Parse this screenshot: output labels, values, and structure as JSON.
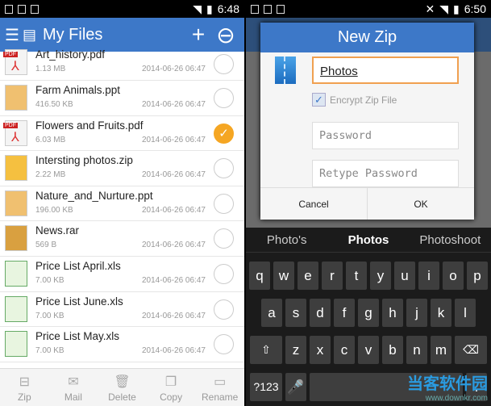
{
  "left": {
    "status_time": "6:48",
    "title": "My Files",
    "files": [
      {
        "name": "Art_history.pdf",
        "size": "1.13 MB",
        "date": "2014-06-26 06:47",
        "type": "pdf",
        "checked": false
      },
      {
        "name": "Farm Animals.ppt",
        "size": "416.50 KB",
        "date": "2014-06-26 06:47",
        "type": "ppt",
        "checked": false
      },
      {
        "name": "Flowers and Fruits.pdf",
        "size": "6.03 MB",
        "date": "2014-06-26 06:47",
        "type": "pdf",
        "checked": true
      },
      {
        "name": "Intersting photos.zip",
        "size": "2.22 MB",
        "date": "2014-06-26 06:47",
        "type": "zip",
        "checked": false
      },
      {
        "name": "Nature_and_Nurture.ppt",
        "size": "196.00 KB",
        "date": "2014-06-26 06:47",
        "type": "ppt",
        "checked": false
      },
      {
        "name": "News.rar",
        "size": "569 B",
        "date": "2014-06-26 06:47",
        "type": "rar",
        "checked": false
      },
      {
        "name": "Price List April.xls",
        "size": "7.00 KB",
        "date": "2014-06-26 06:47",
        "type": "xls",
        "checked": false
      },
      {
        "name": "Price List June.xls",
        "size": "7.00 KB",
        "date": "2014-06-26 06:47",
        "type": "xls",
        "checked": false
      },
      {
        "name": "Price List May.xls",
        "size": "7.00 KB",
        "date": "2014-06-26 06:47",
        "type": "xls",
        "checked": false
      }
    ],
    "toolbar": [
      {
        "label": "Zip",
        "icon": "zip-icon"
      },
      {
        "label": "Mail",
        "icon": "mail-icon"
      },
      {
        "label": "Delete",
        "icon": "trash-icon"
      },
      {
        "label": "Copy",
        "icon": "copy-icon"
      },
      {
        "label": "Rename",
        "icon": "rename-icon"
      }
    ]
  },
  "right": {
    "status_time": "6:50",
    "dialog": {
      "title": "New Zip",
      "name_value": "Photos",
      "encrypt_label": "Encrypt Zip File",
      "encrypt_checked": true,
      "password_placeholder": "Password",
      "retype_placeholder": "Retype Password",
      "cancel": "Cancel",
      "ok": "OK"
    },
    "suggestions": [
      "Photo's",
      "Photos",
      "Photoshoot"
    ],
    "keys": {
      "row1": [
        "q",
        "w",
        "e",
        "r",
        "t",
        "y",
        "u",
        "i",
        "o",
        "p"
      ],
      "row2": [
        "a",
        "s",
        "d",
        "f",
        "g",
        "h",
        "j",
        "k",
        "l"
      ],
      "row3": [
        "z",
        "x",
        "c",
        "v",
        "b",
        "n",
        "m"
      ],
      "symbols": "?123"
    }
  },
  "watermark": {
    "text": "当客软件园",
    "url": "www.downkr.com"
  },
  "colors": {
    "accent": "#3d78c8",
    "check": "#f5a623",
    "focus": "#f0a050"
  }
}
